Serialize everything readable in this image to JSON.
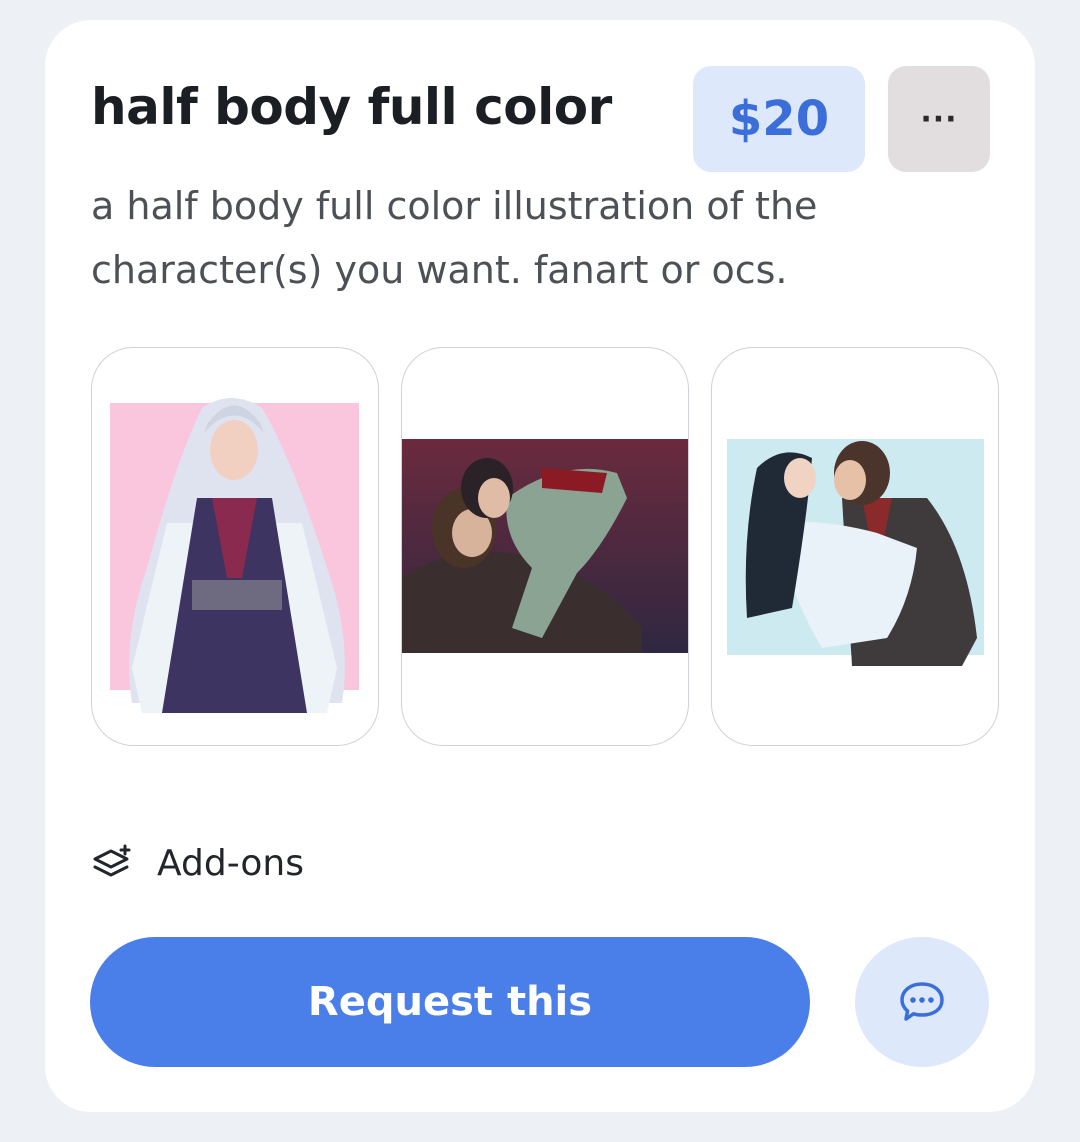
{
  "listing": {
    "title": "half body full color",
    "price": "$20",
    "more_label": "···",
    "description": "a half body full color illustration of the character(s) you want. fanart or ocs."
  },
  "gallery": [
    {
      "icon": "illustration-white-haired-figure"
    },
    {
      "icon": "illustration-two-figures-dark"
    },
    {
      "icon": "illustration-two-figures-light"
    }
  ],
  "addons": {
    "label": "Add-ons",
    "icon": "layers-plus-icon"
  },
  "actions": {
    "request_label": "Request this",
    "chat_icon": "chat-bubble-icon"
  },
  "colors": {
    "accent": "#4a7ee8",
    "price_bg": "#dde8fa",
    "price_text": "#3b6ed9",
    "page_bg": "#edf0f5"
  }
}
